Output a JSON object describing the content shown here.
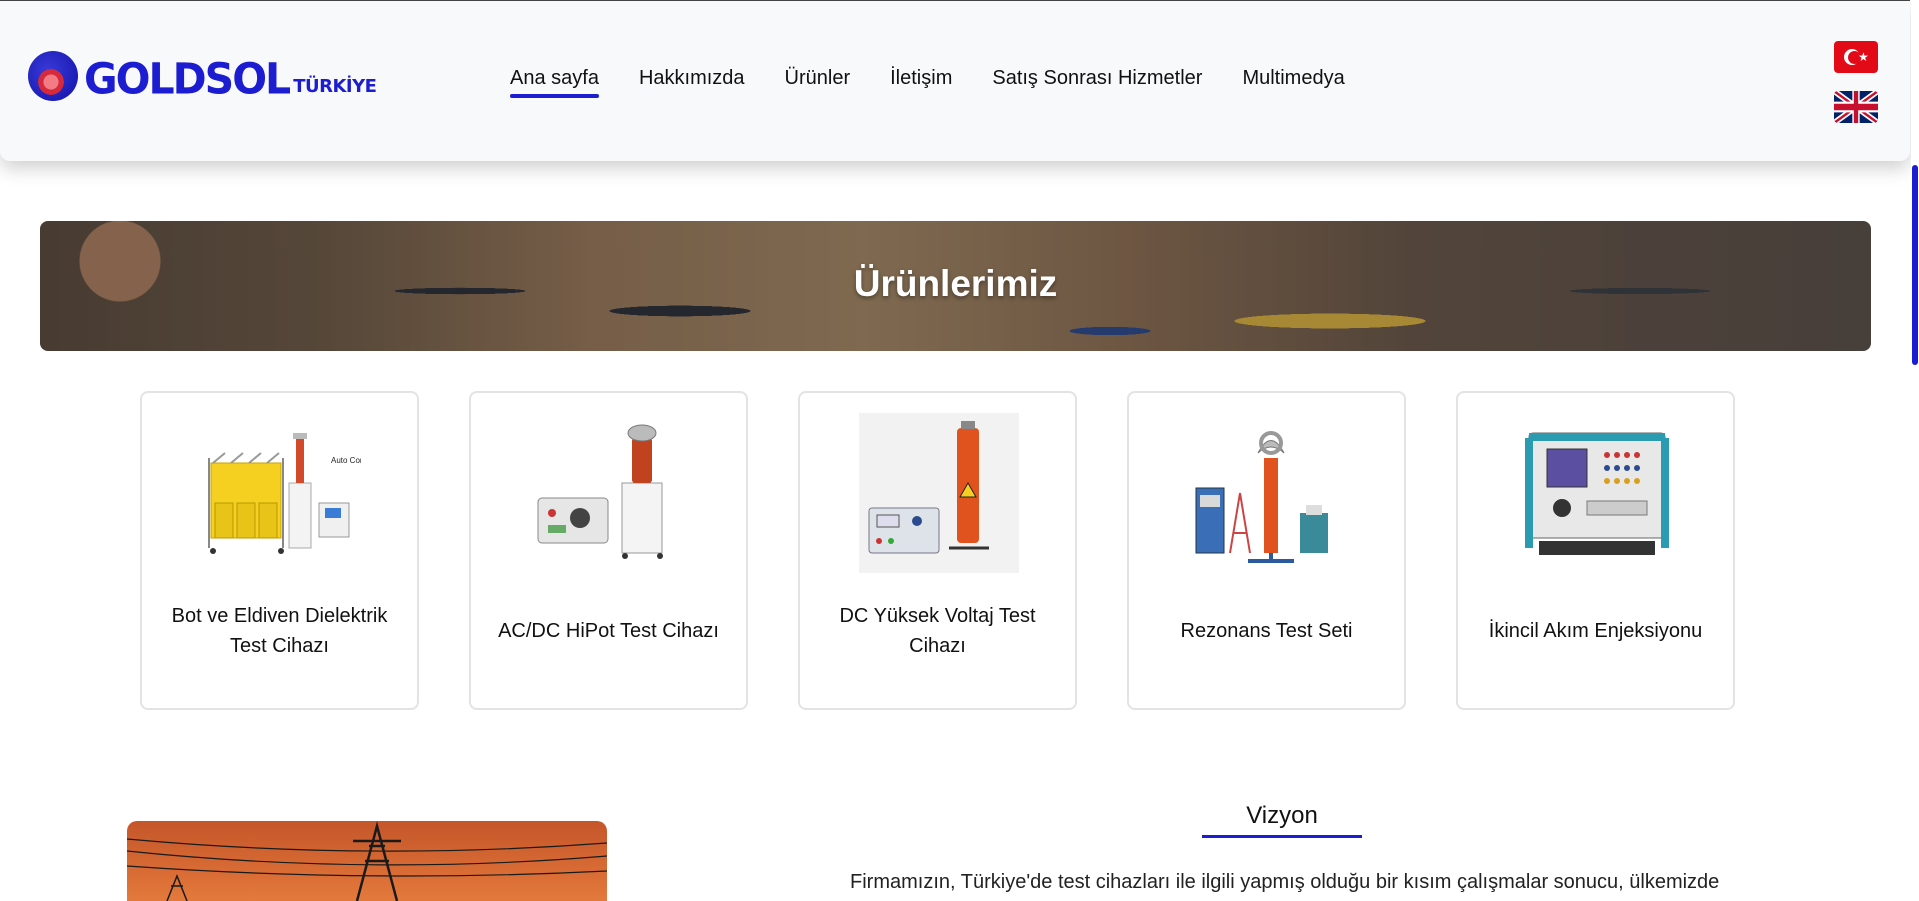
{
  "header": {
    "logo": {
      "name": "GOLDSOL",
      "sub": "TÜRKİYE"
    },
    "nav": [
      {
        "label": "Ana sayfa",
        "active": true
      },
      {
        "label": "Hakkımızda",
        "active": false
      },
      {
        "label": "Ürünler",
        "active": false
      },
      {
        "label": "İletişim",
        "active": false
      },
      {
        "label": "Satış Sonrası Hizmetler",
        "active": false
      },
      {
        "label": "Multimedya",
        "active": false
      }
    ],
    "languages": [
      "turkish-flag-icon",
      "uk-flag-icon"
    ]
  },
  "banner": {
    "title": "Ürünlerimiz"
  },
  "products": [
    {
      "label": "Bot ve Eldiven Dielektrik Test Cihazı",
      "image": "boot-glove-tester-image",
      "image_caption": "Auto Control"
    },
    {
      "label": "AC/DC HiPot Test Cihazı",
      "image": "hipot-tester-image"
    },
    {
      "label": "DC Yüksek Voltaj Test Cihazı",
      "image": "dc-hv-tester-image"
    },
    {
      "label": "Rezonans Test Seti",
      "image": "resonance-set-image"
    },
    {
      "label": "İkincil Akım Enjeksiyonu",
      "image": "current-injection-image"
    }
  ],
  "vision": {
    "title": "Vizyon",
    "text": "Firmamızın, Türkiye'de test cihazları ile ilgili yapmış olduğu bir kısım çalışmalar sonucu, ülkemizde"
  },
  "colors": {
    "accent": "#1c1cd0",
    "header_bg": "#f8f9fb",
    "card_border": "#e3e3e3"
  }
}
